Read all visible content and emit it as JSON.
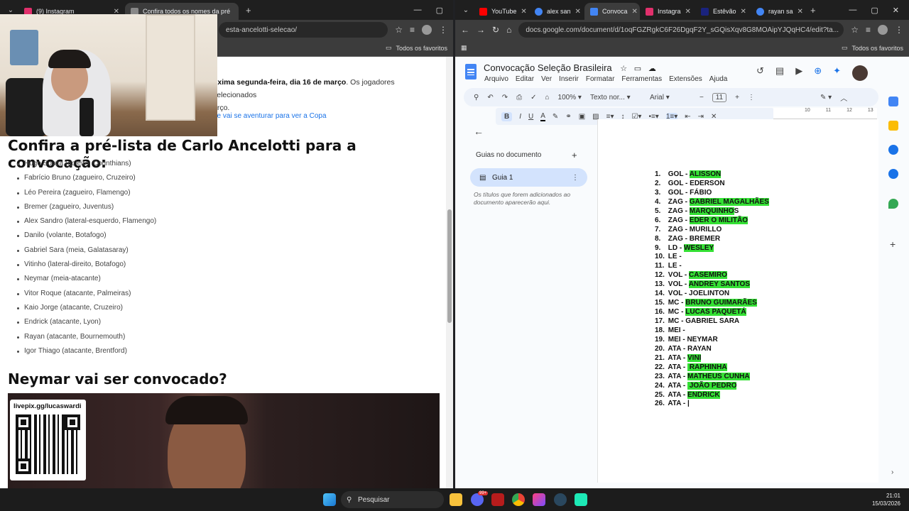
{
  "left_window": {
    "tabs": [
      {
        "label": "(9) Instagram",
        "color": "#e1306c"
      },
      {
        "label": "Confira todos os nomes da pré",
        "color": "#888888"
      }
    ],
    "url": "esta-ancelotti-selecao/",
    "bookmarks_label": "Todos os favoritos",
    "article": {
      "intro_bold": "óxima segunda-feira, dia 16 de março",
      "intro_rest": ". Os jogadores selecionados",
      "intro_line2": "arço.",
      "link_text": "ue vai se aventurar para ver a Copa",
      "heading1": "Confira a pré-lista de Carlo Ancelotti para a convocação:",
      "players": [
        "Hugo Souza (goleiro, Corinthians)",
        "Fabrício Bruno (zagueiro, Cruzeiro)",
        "Léo Pereira (zagueiro, Flamengo)",
        "Bremer (zagueiro, Juventus)",
        "Alex Sandro (lateral-esquerdo, Flamengo)",
        "Danilo (volante, Botafogo)",
        "Gabriel Sara (meia, Galatasaray)",
        "Vitinho (lateral-direito, Botafogo)",
        "Neymar (meia-atacante)",
        "Vitor Roque (atacante, Palmeiras)",
        "Kaio Jorge (atacante, Cruzeiro)",
        "Endrick (atacante, Lyon)",
        "Rayan (atacante, Bournemouth)",
        "Igor Thiago (atacante, Brentford)"
      ],
      "heading2": "Neymar vai ser convocado?",
      "qr_label": "livepix.gg/lucaswardi"
    }
  },
  "right_window": {
    "tabs": [
      {
        "label": "YouTube",
        "color": "#ff0000"
      },
      {
        "label": "alex san",
        "color": "#4285f4"
      },
      {
        "label": "Convoca",
        "color": "#4285f4"
      },
      {
        "label": "Instagra",
        "color": "#e1306c"
      },
      {
        "label": "Estêvão",
        "color": "#1a237e"
      },
      {
        "label": "rayan sa",
        "color": "#4285f4"
      }
    ],
    "url": "docs.google.com/document/d/1oqFGZRgkC6F26DgqF2Y_sGQisXqv8G8MOAipYJQqHC4/edit?ta...",
    "bookmarks_label": "Todos os favoritos",
    "doc_title": "Convocação Seleção Brasileira",
    "menu": [
      "Arquivo",
      "Editar",
      "Ver",
      "Inserir",
      "Formatar",
      "Ferramentas",
      "Extensões",
      "Ajuda"
    ],
    "zoom": "100%",
    "style": "Texto nor...",
    "font": "Arial",
    "font_size": "11",
    "ruler_ticks": [
      "10",
      "11",
      "12",
      "13"
    ],
    "outline_title": "Guias no documento",
    "outline_tab": "Guia 1",
    "outline_note": "Os títulos que forem adicionados ao documento aparecerão aqui.",
    "list": [
      {
        "n": "1.",
        "pre": "GOL - ",
        "hl": "ALISSON",
        "post": ""
      },
      {
        "n": "2.",
        "pre": "GOL - EDERSON",
        "hl": "",
        "post": ""
      },
      {
        "n": "3.",
        "pre": "GOL - FÁBIO",
        "hl": "",
        "post": ""
      },
      {
        "n": "4.",
        "pre": "ZAG - ",
        "hl": "GABRIEL MAGALHÃES",
        "post": ""
      },
      {
        "n": "5.",
        "pre": "ZAG - ",
        "hl": "MARQUINHO",
        "post": "S"
      },
      {
        "n": "6.",
        "pre": "ZAG - ",
        "hl": "EDER O MILITÃO",
        "post": ""
      },
      {
        "n": "7.",
        "pre": "ZAG - MURILLO",
        "hl": "",
        "post": ""
      },
      {
        "n": "8.",
        "pre": "ZAG - BREMER",
        "hl": "",
        "post": ""
      },
      {
        "n": "9.",
        "pre": "LD - ",
        "hl": "WESLEY",
        "post": ""
      },
      {
        "n": "10.",
        "pre": "LE -",
        "hl": "",
        "post": ""
      },
      {
        "n": "11.",
        "pre": "LE -",
        "hl": "",
        "post": ""
      },
      {
        "n": "12.",
        "pre": "VOL - ",
        "hl": "CASEMIRO",
        "post": ""
      },
      {
        "n": "13.",
        "pre": "VOL - ",
        "hl": "ANDREY SANTOS",
        "post": ""
      },
      {
        "n": "14.",
        "pre": "VOL - JOELINTON",
        "hl": "",
        "post": ""
      },
      {
        "n": "15.",
        "pre": "MC - ",
        "hl": "BRUNO GUIMARÃES",
        "post": ""
      },
      {
        "n": "16.",
        "pre": "MC - ",
        "hl": "LUCAS PAQUETÁ",
        "post": ""
      },
      {
        "n": "17.",
        "pre": "MC - GABRIEL SARA",
        "hl": "",
        "post": ""
      },
      {
        "n": "18.",
        "pre": "MEI -",
        "hl": "",
        "post": ""
      },
      {
        "n": "19.",
        "pre": "MEI - NEYMAR",
        "hl": "",
        "post": ""
      },
      {
        "n": "20.",
        "pre": "ATA - RAYAN",
        "hl": "",
        "post": ""
      },
      {
        "n": "21.",
        "pre": "ATA - ",
        "hl": "VINI",
        "post": ""
      },
      {
        "n": "22.",
        "pre": "ATA - ",
        "hl": " RAPHINHA",
        "post": ""
      },
      {
        "n": "23.",
        "pre": "ATA - ",
        "hl": "MATHEUS CUNHA",
        "post": ""
      },
      {
        "n": "24.",
        "pre": "ATA - ",
        "hl": " JOÃO PEDRO",
        "post": ""
      },
      {
        "n": "25.",
        "pre": "ATA - ",
        "hl": "ENDRICK",
        "post": ""
      },
      {
        "n": "26.",
        "pre": "ATA - |",
        "hl": "",
        "post": ""
      }
    ],
    "highlight_color": "#34e034"
  },
  "taskbar": {
    "search_placeholder": "Pesquisar",
    "badge": "99+",
    "time": "21:01",
    "date": "15/03/2026"
  }
}
